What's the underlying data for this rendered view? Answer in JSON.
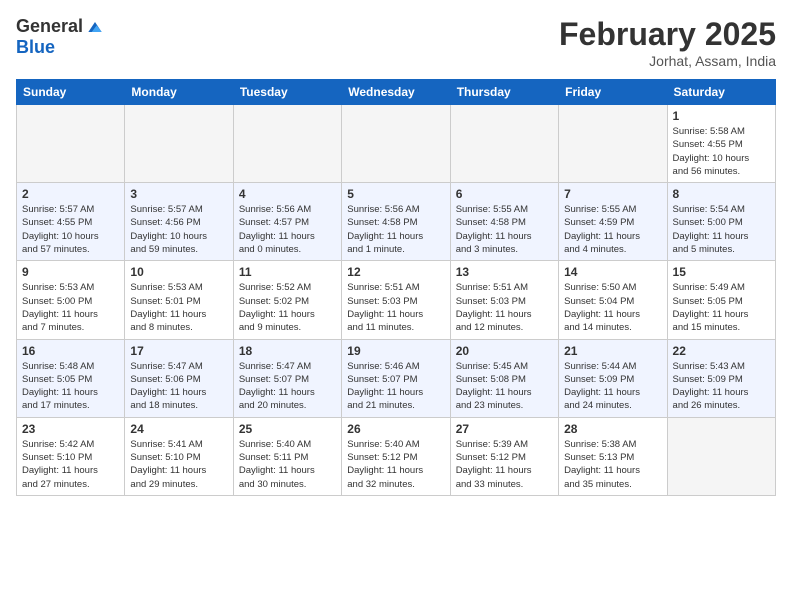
{
  "logo": {
    "general": "General",
    "blue": "Blue"
  },
  "header": {
    "month": "February 2025",
    "location": "Jorhat, Assam, India"
  },
  "days_of_week": [
    "Sunday",
    "Monday",
    "Tuesday",
    "Wednesday",
    "Thursday",
    "Friday",
    "Saturday"
  ],
  "weeks": [
    [
      {
        "day": "",
        "info": ""
      },
      {
        "day": "",
        "info": ""
      },
      {
        "day": "",
        "info": ""
      },
      {
        "day": "",
        "info": ""
      },
      {
        "day": "",
        "info": ""
      },
      {
        "day": "",
        "info": ""
      },
      {
        "day": "1",
        "info": "Sunrise: 5:58 AM\nSunset: 4:55 PM\nDaylight: 10 hours\nand 56 minutes."
      }
    ],
    [
      {
        "day": "2",
        "info": "Sunrise: 5:57 AM\nSunset: 4:55 PM\nDaylight: 10 hours\nand 57 minutes."
      },
      {
        "day": "3",
        "info": "Sunrise: 5:57 AM\nSunset: 4:56 PM\nDaylight: 10 hours\nand 59 minutes."
      },
      {
        "day": "4",
        "info": "Sunrise: 5:56 AM\nSunset: 4:57 PM\nDaylight: 11 hours\nand 0 minutes."
      },
      {
        "day": "5",
        "info": "Sunrise: 5:56 AM\nSunset: 4:58 PM\nDaylight: 11 hours\nand 1 minute."
      },
      {
        "day": "6",
        "info": "Sunrise: 5:55 AM\nSunset: 4:58 PM\nDaylight: 11 hours\nand 3 minutes."
      },
      {
        "day": "7",
        "info": "Sunrise: 5:55 AM\nSunset: 4:59 PM\nDaylight: 11 hours\nand 4 minutes."
      },
      {
        "day": "8",
        "info": "Sunrise: 5:54 AM\nSunset: 5:00 PM\nDaylight: 11 hours\nand 5 minutes."
      }
    ],
    [
      {
        "day": "9",
        "info": "Sunrise: 5:53 AM\nSunset: 5:00 PM\nDaylight: 11 hours\nand 7 minutes."
      },
      {
        "day": "10",
        "info": "Sunrise: 5:53 AM\nSunset: 5:01 PM\nDaylight: 11 hours\nand 8 minutes."
      },
      {
        "day": "11",
        "info": "Sunrise: 5:52 AM\nSunset: 5:02 PM\nDaylight: 11 hours\nand 9 minutes."
      },
      {
        "day": "12",
        "info": "Sunrise: 5:51 AM\nSunset: 5:03 PM\nDaylight: 11 hours\nand 11 minutes."
      },
      {
        "day": "13",
        "info": "Sunrise: 5:51 AM\nSunset: 5:03 PM\nDaylight: 11 hours\nand 12 minutes."
      },
      {
        "day": "14",
        "info": "Sunrise: 5:50 AM\nSunset: 5:04 PM\nDaylight: 11 hours\nand 14 minutes."
      },
      {
        "day": "15",
        "info": "Sunrise: 5:49 AM\nSunset: 5:05 PM\nDaylight: 11 hours\nand 15 minutes."
      }
    ],
    [
      {
        "day": "16",
        "info": "Sunrise: 5:48 AM\nSunset: 5:05 PM\nDaylight: 11 hours\nand 17 minutes."
      },
      {
        "day": "17",
        "info": "Sunrise: 5:47 AM\nSunset: 5:06 PM\nDaylight: 11 hours\nand 18 minutes."
      },
      {
        "day": "18",
        "info": "Sunrise: 5:47 AM\nSunset: 5:07 PM\nDaylight: 11 hours\nand 20 minutes."
      },
      {
        "day": "19",
        "info": "Sunrise: 5:46 AM\nSunset: 5:07 PM\nDaylight: 11 hours\nand 21 minutes."
      },
      {
        "day": "20",
        "info": "Sunrise: 5:45 AM\nSunset: 5:08 PM\nDaylight: 11 hours\nand 23 minutes."
      },
      {
        "day": "21",
        "info": "Sunrise: 5:44 AM\nSunset: 5:09 PM\nDaylight: 11 hours\nand 24 minutes."
      },
      {
        "day": "22",
        "info": "Sunrise: 5:43 AM\nSunset: 5:09 PM\nDaylight: 11 hours\nand 26 minutes."
      }
    ],
    [
      {
        "day": "23",
        "info": "Sunrise: 5:42 AM\nSunset: 5:10 PM\nDaylight: 11 hours\nand 27 minutes."
      },
      {
        "day": "24",
        "info": "Sunrise: 5:41 AM\nSunset: 5:10 PM\nDaylight: 11 hours\nand 29 minutes."
      },
      {
        "day": "25",
        "info": "Sunrise: 5:40 AM\nSunset: 5:11 PM\nDaylight: 11 hours\nand 30 minutes."
      },
      {
        "day": "26",
        "info": "Sunrise: 5:40 AM\nSunset: 5:12 PM\nDaylight: 11 hours\nand 32 minutes."
      },
      {
        "day": "27",
        "info": "Sunrise: 5:39 AM\nSunset: 5:12 PM\nDaylight: 11 hours\nand 33 minutes."
      },
      {
        "day": "28",
        "info": "Sunrise: 5:38 AM\nSunset: 5:13 PM\nDaylight: 11 hours\nand 35 minutes."
      },
      {
        "day": "",
        "info": ""
      }
    ]
  ]
}
